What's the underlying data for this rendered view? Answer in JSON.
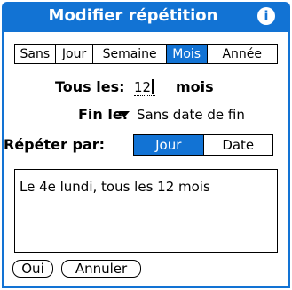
{
  "colors": {
    "accent": "#1273d4"
  },
  "dialog": {
    "title": "Modifier répétition",
    "info_icon": "i"
  },
  "period_tabs": [
    "Sans",
    "Jour",
    "Semaine",
    "Mois",
    "Année"
  ],
  "period_selected": "Mois",
  "interval": {
    "label": "Tous les:",
    "value": "12",
    "unit": "mois"
  },
  "end": {
    "label": "Fin le:",
    "value": "Sans date de fin"
  },
  "repeat_by": {
    "label": "Répéter par:",
    "options": [
      "Jour",
      "Date"
    ],
    "selected": "Jour"
  },
  "description": "Le 4e lundi, tous les 12 mois",
  "buttons": {
    "ok": "Oui",
    "cancel": "Annuler"
  }
}
